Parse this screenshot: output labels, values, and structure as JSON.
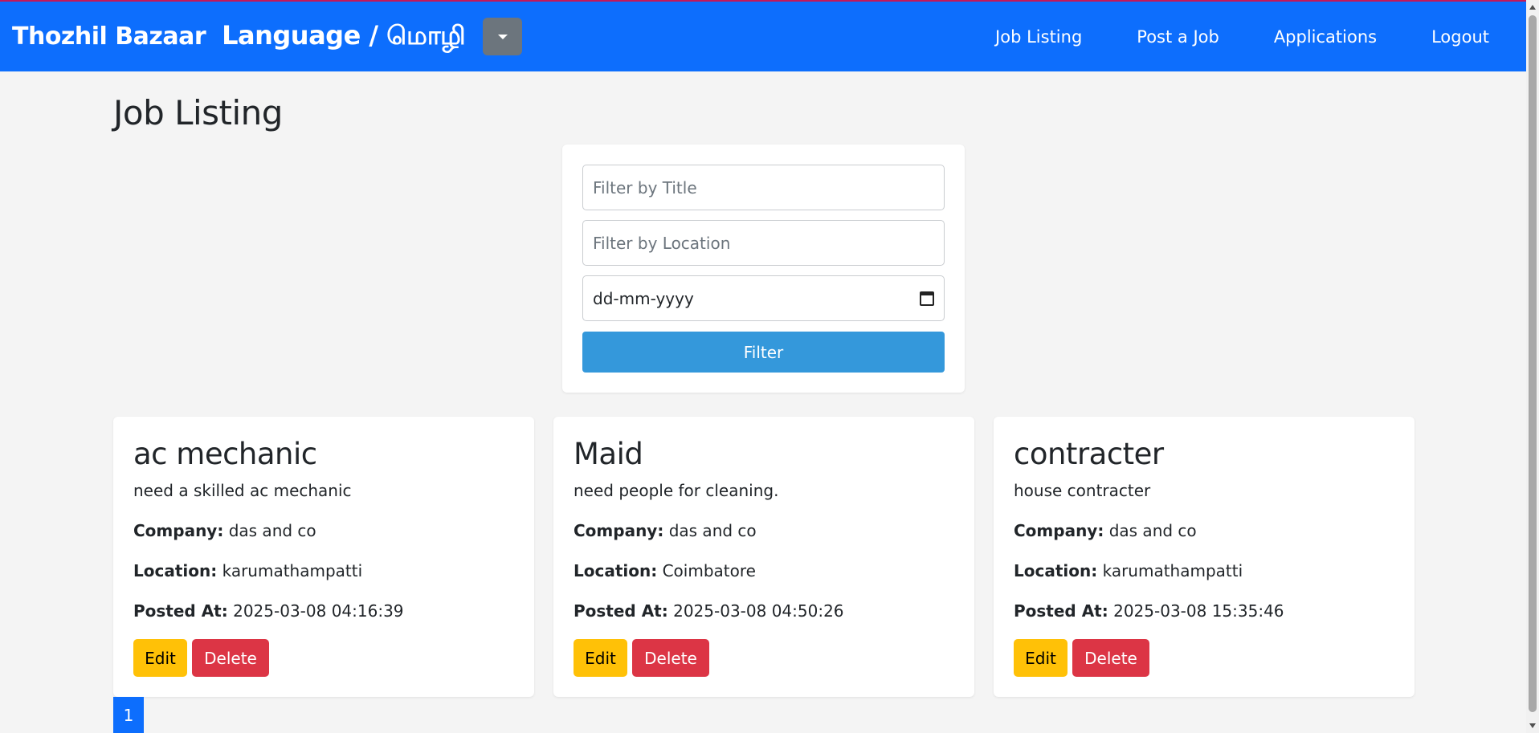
{
  "navbar": {
    "brand": "Thozhil Bazaar",
    "language_label": "Language / மொழி",
    "links": [
      "Job Listing",
      "Post a Job",
      "Applications",
      "Logout"
    ]
  },
  "page": {
    "title": "Job Listing"
  },
  "filter": {
    "title_placeholder": "Filter by Title",
    "location_placeholder": "Filter by Location",
    "date_placeholder": "dd-mm-yyyy",
    "button_label": "Filter"
  },
  "jobs": [
    {
      "title": "ac mechanic",
      "description": "need a skilled ac mechanic",
      "company_label": "Company:",
      "company": "das and co",
      "location_label": "Location:",
      "location": "karumathampatti",
      "posted_label": "Posted At:",
      "posted_at": "2025-03-08 04:16:39",
      "edit_label": "Edit",
      "delete_label": "Delete"
    },
    {
      "title": "Maid",
      "description": "need people for cleaning.",
      "company_label": "Company:",
      "company": "das and co",
      "location_label": "Location:",
      "location": "Coimbatore",
      "posted_label": "Posted At:",
      "posted_at": "2025-03-08 04:50:26",
      "edit_label": "Edit",
      "delete_label": "Delete"
    },
    {
      "title": "contracter",
      "description": "house contracter",
      "company_label": "Company:",
      "company": "das and co",
      "location_label": "Location:",
      "location": "karumathampatti",
      "posted_label": "Posted At:",
      "posted_at": "2025-03-08 15:35:46",
      "edit_label": "Edit",
      "delete_label": "Delete"
    }
  ],
  "pagination": {
    "current": "1"
  },
  "colors": {
    "navbar": "#0d6efd",
    "filter_button": "#3498db",
    "edit_button": "#ffc107",
    "delete_button": "#dc3545",
    "language_button": "#6c757d"
  }
}
